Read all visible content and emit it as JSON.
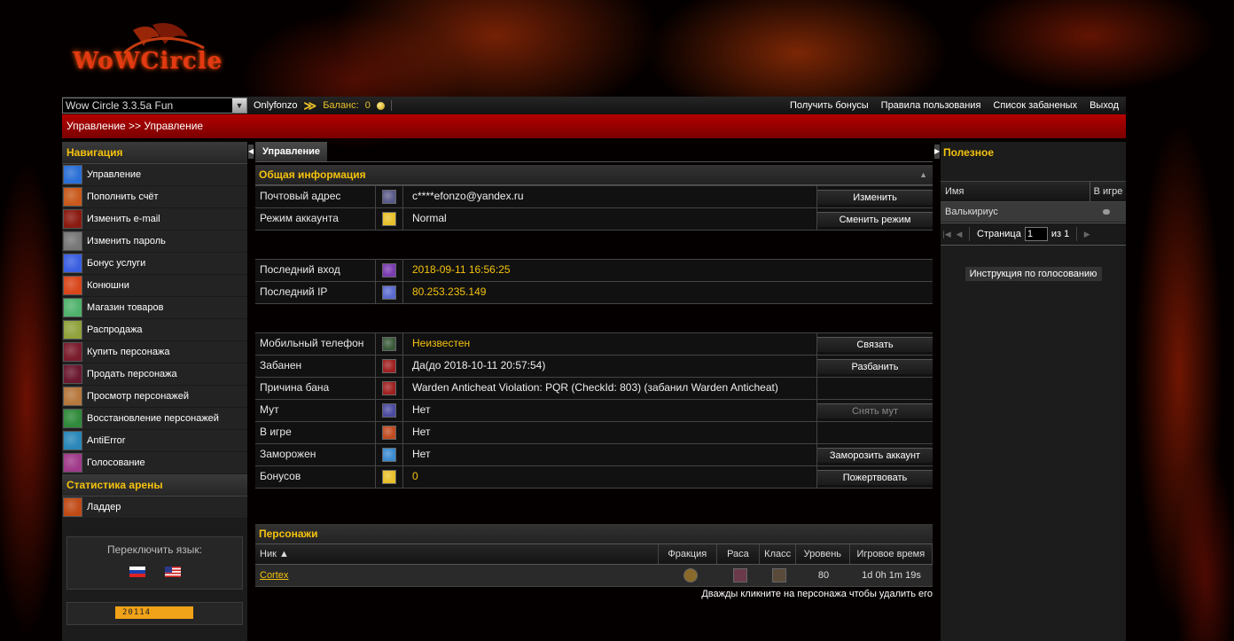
{
  "header": {
    "logo_text": "WoWCircle",
    "realm_selected": "Wow Circle 3.3.5a Fun",
    "username": "Onlyfonzo",
    "balance_label": "Баланс:",
    "balance_value": "0",
    "links": [
      "Получить бонусы",
      "Правила пользования",
      "Список забаненых",
      "Выход"
    ]
  },
  "breadcrumb": "Управление >> Управление",
  "navigation": {
    "title": "Навигация",
    "items": [
      {
        "label": "Управление",
        "icon": "management-icon",
        "color": "#2a6fd6"
      },
      {
        "label": "Пополнить счёт",
        "icon": "refill-icon",
        "color": "#c8591b"
      },
      {
        "label": "Изменить e-mail",
        "icon": "email-icon",
        "color": "#8a1a10"
      },
      {
        "label": "Изменить пароль",
        "icon": "password-icon",
        "color": "#777777"
      },
      {
        "label": "Бонус услуги",
        "icon": "bonus-services-icon",
        "color": "#3a5fe0"
      },
      {
        "label": "Конюшни",
        "icon": "stables-icon",
        "color": "#d9461a"
      },
      {
        "label": "Магазин товаров",
        "icon": "shop-icon",
        "color": "#4fb26b"
      },
      {
        "label": "Распродажа",
        "icon": "sale-icon",
        "color": "#8fa23c"
      },
      {
        "label": "Купить персонажа",
        "icon": "buy-character-icon",
        "color": "#7a1c2c"
      },
      {
        "label": "Продать персонажа",
        "icon": "sell-character-icon",
        "color": "#6a1830"
      },
      {
        "label": "Просмотр персонажей",
        "icon": "view-characters-icon",
        "color": "#b6773c"
      },
      {
        "label": "Восстановление персонажей",
        "icon": "restore-characters-icon",
        "color": "#2f8a3a"
      },
      {
        "label": "AntiError",
        "icon": "antierror-icon",
        "color": "#2a87b8"
      },
      {
        "label": "Голосование",
        "icon": "voting-icon",
        "color": "#a03a8a"
      }
    ],
    "arena_title": "Статистика арены",
    "arena_items": [
      {
        "label": "Ладдер",
        "icon": "ladder-icon",
        "color": "#c04a16"
      }
    ]
  },
  "language": {
    "title": "Переключить язык:"
  },
  "counter": "20114",
  "main": {
    "tab": "Управление",
    "general_title": "Общая информация",
    "group1": [
      {
        "label": "Почтовый адрес",
        "icon": "mail-address-icon",
        "color": "#5a5a8a",
        "value": "c****efonzo@yandex.ru",
        "gold": false,
        "button": "Изменить",
        "disabled": false
      },
      {
        "label": "Режим аккаунта",
        "icon": "star-icon",
        "color": "#e8c02a",
        "value": "Normal",
        "gold": false,
        "button": "Сменить режим",
        "disabled": false
      }
    ],
    "group2": [
      {
        "label": "Последний вход",
        "icon": "last-login-icon",
        "color": "#7a3ab0",
        "value": "2018-09-11 16:56:25",
        "gold": true
      },
      {
        "label": "Последний IP",
        "icon": "last-ip-icon",
        "color": "#5a6ad0",
        "value": "80.253.235.149",
        "gold": true
      }
    ],
    "group3": [
      {
        "label": "Мобильный телефон",
        "icon": "phone-icon",
        "color": "#3a5a3a",
        "value": "Неизвестен",
        "gold": true,
        "button": "Связать",
        "disabled": false
      },
      {
        "label": "Забанен",
        "icon": "ban-icon",
        "color": "#a02020",
        "value": "Да(до 2018-10-11 20:57:54)",
        "gold": false,
        "button": "Разбанить",
        "disabled": false
      },
      {
        "label": "Причина бана",
        "icon": "ban-reason-icon",
        "color": "#a02020",
        "value": "Warden Anticheat Violation: PQR (CheckId: 803) (забанил Warden Anticheat)",
        "gold": false,
        "button": "",
        "disabled": false
      },
      {
        "label": "Мут",
        "icon": "mute-icon",
        "color": "#4a4aa0",
        "value": "Нет",
        "gold": false,
        "button": "Снять мут",
        "disabled": true
      },
      {
        "label": "В игре",
        "icon": "in-game-icon",
        "color": "#c04a20",
        "value": "Нет",
        "gold": false,
        "button": "",
        "disabled": false
      },
      {
        "label": "Заморожен",
        "icon": "frozen-icon",
        "color": "#3a8ad0",
        "value": "Нет",
        "gold": false,
        "button": "Заморозить аккаунт",
        "disabled": false
      },
      {
        "label": "Бонусов",
        "icon": "bonus-coin-icon",
        "color": "#e8c02a",
        "value": "0",
        "gold": true,
        "button": "Пожертвовать",
        "disabled": false
      }
    ],
    "characters_title": "Персонажи",
    "columns": [
      "Ник ▲",
      "Фракция",
      "Раса",
      "Класс",
      "Уровень",
      "Игровое время"
    ],
    "characters": [
      {
        "name": "Cortex",
        "level": "80",
        "time": "1d 0h 1m 19s"
      }
    ],
    "characters_note": "Дважды кликните на персонажа чтобы удалить его"
  },
  "sidebar_right": {
    "title": "Полезное",
    "col_name": "Имя",
    "col_ingame": "В игре",
    "gm_name": "Валькириус",
    "page_label": "Страница",
    "page_value": "1",
    "page_of": "из 1",
    "vote_button": "Инструкция по голосованию"
  }
}
